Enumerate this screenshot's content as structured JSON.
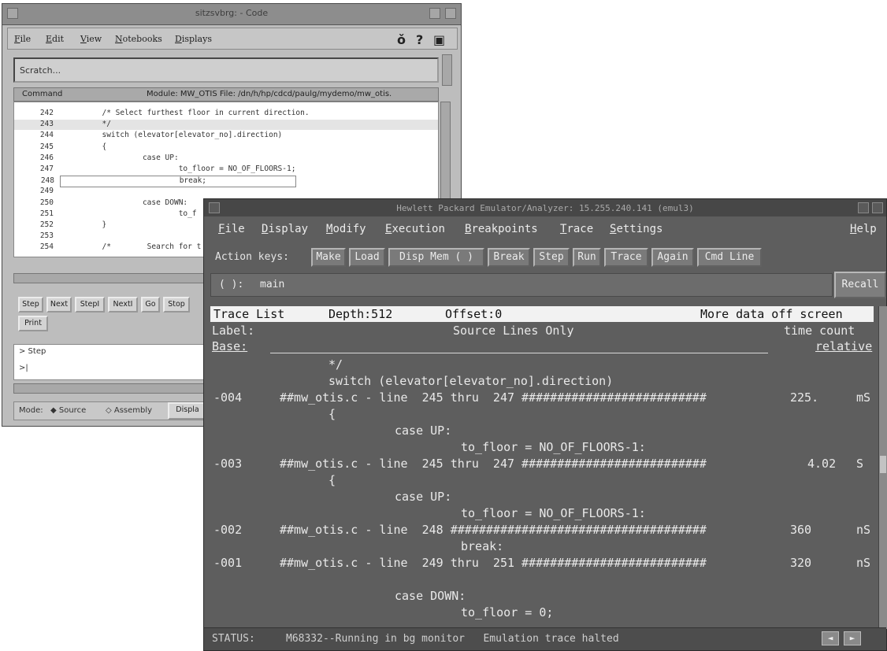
{
  "back_window": {
    "title": "sitzsvbrg: - Code",
    "menu": [
      "File",
      "Edit",
      "View",
      "Notebooks",
      "Displays"
    ],
    "toolbar_icons": [
      "pointer-icon",
      "help-icon",
      "key-icon"
    ],
    "toolbar_glyphs": [
      "ǒ",
      "?",
      "▣"
    ],
    "scratch_label": "Scratch...",
    "code_header": {
      "command": "Command",
      "module": "Module: MW_OTIS File: /dn/h/hp/cdcd/paulg/mydemo/mw_otis."
    },
    "code_lines": [
      {
        "n": "242",
        "s": "         /* Select furthest floor in current direction."
      },
      {
        "n": "243",
        "s": "         */"
      },
      {
        "n": "244",
        "s": "         switch (elevator[elevator_no].direction)"
      },
      {
        "n": "245",
        "s": "         {"
      },
      {
        "n": "246",
        "s": "                  case UP:"
      },
      {
        "n": "247",
        "s": "                          to_floor = NO_OF_FLOORS-1;"
      },
      {
        "n": "248",
        "s": "                          break;"
      },
      {
        "n": "249",
        "s": ""
      },
      {
        "n": "250",
        "s": "                  case DOWN:"
      },
      {
        "n": "251",
        "s": "                          to_f"
      },
      {
        "n": "252",
        "s": "         }"
      },
      {
        "n": "253",
        "s": ""
      },
      {
        "n": "254",
        "s": "         /*        Search for t"
      }
    ],
    "step_buttons": [
      "Step",
      "Next",
      "StepI",
      "NextI",
      "Go",
      "Stop"
    ],
    "print_button": "Print",
    "command_history": [
      "> Step",
      ">|"
    ],
    "mode_label": "Mode:",
    "mode_options": [
      "Source",
      "Assembly"
    ],
    "mode_extra": "Displa"
  },
  "front_window": {
    "title": "Hewlett Packard Emulator/Analyzer: 15.255.240.141 (emul3)",
    "menu": [
      "File",
      "Display",
      "Modify",
      "Execution",
      "Breakpoints",
      "Trace",
      "Settings"
    ],
    "help": "Help",
    "action_keys_label": "Action keys:",
    "action_keys": [
      "Make",
      "Load",
      "Disp Mem ( )",
      "Break",
      "Step",
      "Run",
      "Trace",
      "Again",
      "Cmd Line"
    ],
    "command_prompt": "( ):",
    "command_value": "main",
    "recall_button": "Recall",
    "trace_header": {
      "title": "Trace List",
      "depth": "Depth:512",
      "offset": "Offset:0",
      "more": "More data off screen"
    },
    "label_row": {
      "label": "Label:",
      "source": "Source Lines Only",
      "time_count": "time count"
    },
    "base_row": {
      "base": "Base:",
      "relative": "relative"
    },
    "trace_lines": [
      {
        "state": "",
        "text": "*/",
        "time": "",
        "unit": ""
      },
      {
        "state": "",
        "text": "switch (elevator[elevator_no].direction)",
        "time": "",
        "unit": ""
      },
      {
        "state": "-004",
        "text": "##mw_otis.c - line  245 thru  247 ##########################",
        "time": "225.",
        "unit": "mS"
      },
      {
        "state": "",
        "text": "{",
        "time": "",
        "unit": ""
      },
      {
        "state": "",
        "text": "case UP:",
        "time": "",
        "unit": ""
      },
      {
        "state": "",
        "text": "to_floor = NO_OF_FLOORS-1:",
        "time": "",
        "unit": ""
      },
      {
        "state": "-003",
        "text": "##mw_otis.c - line  245 thru  247 ##########################",
        "time": "4.02",
        "unit": "S"
      },
      {
        "state": "",
        "text": "{",
        "time": "",
        "unit": ""
      },
      {
        "state": "",
        "text": "case UP:",
        "time": "",
        "unit": ""
      },
      {
        "state": "",
        "text": "to_floor = NO_OF_FLOORS-1:",
        "time": "",
        "unit": ""
      },
      {
        "state": "-002",
        "text": "##mw_otis.c - line  248 ####################################",
        "time": "360",
        "unit": "nS"
      },
      {
        "state": "",
        "text": "break:",
        "time": "",
        "unit": ""
      },
      {
        "state": "-001",
        "text": "##mw_otis.c - line  249 thru  251 ##########################",
        "time": "320",
        "unit": "nS"
      },
      {
        "state": "",
        "text": "",
        "time": "",
        "unit": ""
      },
      {
        "state": "",
        "text": "case DOWN:",
        "time": "",
        "unit": ""
      },
      {
        "state": "",
        "text": "to_floor = 0;",
        "time": "",
        "unit": ""
      }
    ],
    "status": {
      "label": "STATUS:",
      "message": "M68332--Running in bg monitor   Emulation trace halted"
    },
    "status_arrows": [
      "◄",
      "►"
    ]
  }
}
